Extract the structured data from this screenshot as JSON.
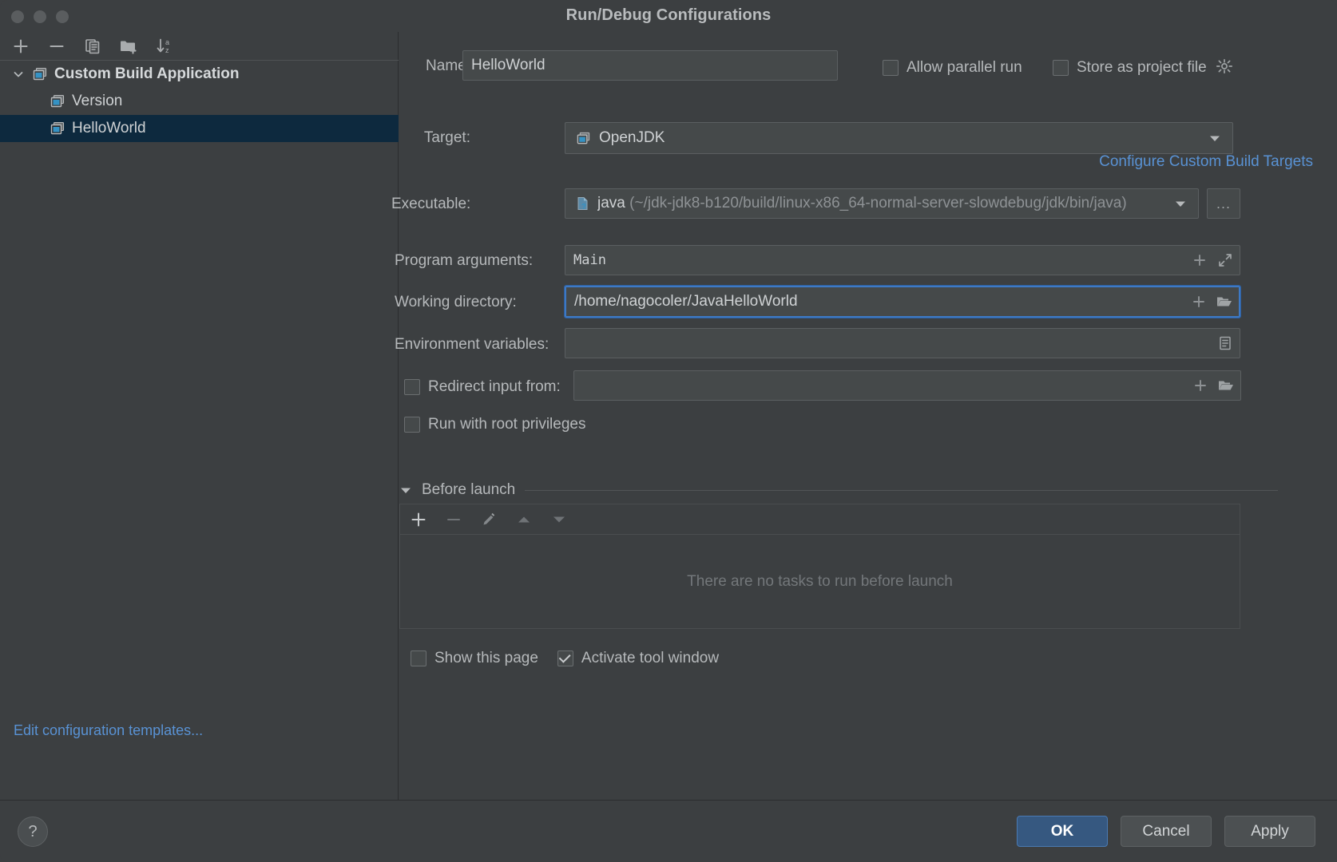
{
  "window": {
    "title": "Run/Debug Configurations",
    "traffic_lights": [
      "close",
      "minimize",
      "zoom"
    ]
  },
  "sidebar": {
    "toolbar": [
      {
        "name": "add-configuration-button",
        "icon": "plus-icon",
        "label": "+"
      },
      {
        "name": "remove-configuration-button",
        "icon": "minus-icon",
        "label": "−"
      },
      {
        "name": "copy-configuration-button",
        "icon": "copy-icon",
        "label": "Copy Configuration"
      },
      {
        "name": "new-folder-button",
        "icon": "folder-add-icon",
        "label": "Create New Folder"
      },
      {
        "name": "sort-configurations-button",
        "icon": "sort-alpha-icon",
        "label": "Sort Configurations"
      }
    ],
    "tree": [
      {
        "label": "Custom Build Application",
        "level": 0,
        "expanded": true,
        "selected": false,
        "icon": "configuration-type-icon"
      },
      {
        "label": "Version",
        "level": 1,
        "expanded": false,
        "selected": false,
        "icon": "configuration-icon"
      },
      {
        "label": "HelloWorld",
        "level": 1,
        "expanded": false,
        "selected": true,
        "icon": "configuration-icon"
      }
    ],
    "edit_templates_link": "Edit configuration templates..."
  },
  "form": {
    "name_label": "Name:",
    "name_value": "HelloWorld",
    "allow_parallel_run": {
      "label": "Allow parallel run",
      "checked": false
    },
    "store_as_project_file": {
      "label": "Store as project file",
      "checked": false
    },
    "target_label": "Target:",
    "target_value": "OpenJDK",
    "configure_targets_link": "Configure Custom Build Targets",
    "executable_label": "Executable:",
    "executable_value": "java",
    "executable_path": "(~/jdk-jdk8-b120/build/linux-x86_64-normal-server-slowdebug/jdk/bin/java)",
    "browse_button_label": "...",
    "program_arguments_label": "Program arguments:",
    "program_arguments_value": "Main",
    "working_directory_label": "Working directory:",
    "working_directory_value": "/home/nagocoler/JavaHelloWorld",
    "environment_variables_label": "Environment variables:",
    "environment_variables_value": "",
    "redirect_input_from": {
      "label": "Redirect input from:",
      "checked": false,
      "value": ""
    },
    "run_with_root_privileges": {
      "label": "Run with root privileges",
      "checked": false
    }
  },
  "before_launch": {
    "title": "Before launch",
    "expanded": true,
    "toolbar": [
      {
        "name": "add-task-button",
        "icon": "plus-icon"
      },
      {
        "name": "remove-task-button",
        "icon": "minus-icon"
      },
      {
        "name": "edit-task-button",
        "icon": "pencil-icon"
      },
      {
        "name": "move-task-up-button",
        "icon": "arrow-up-icon"
      },
      {
        "name": "move-task-down-button",
        "icon": "arrow-down-icon"
      }
    ],
    "empty_text": "There are no tasks to run before launch",
    "tasks": [],
    "show_this_page": {
      "label": "Show this page",
      "checked": false
    },
    "activate_tool_window": {
      "label": "Activate tool window",
      "checked": true
    }
  },
  "footer": {
    "help_label": "?",
    "ok_label": "OK",
    "cancel_label": "Cancel",
    "apply_label": "Apply"
  },
  "colors": {
    "background": "#3c3f41",
    "field_background": "#45494a",
    "selection": "#0d293e",
    "link": "#5992d4",
    "accent_primary": "#365880",
    "focus_border": "#3d79c4",
    "icon_blue": "#3592c4"
  }
}
